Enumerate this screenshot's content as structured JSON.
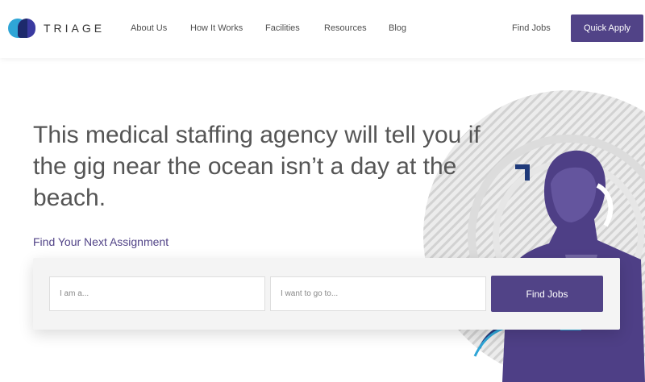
{
  "brand": {
    "name": "TRIAGE"
  },
  "nav": {
    "items": [
      {
        "label": "About Us"
      },
      {
        "label": "How It Works"
      },
      {
        "label": "Facilities"
      },
      {
        "label": "Resources"
      },
      {
        "label": "Blog"
      }
    ],
    "find_jobs": "Find Jobs",
    "quick_apply": "Quick Apply"
  },
  "hero": {
    "headline": "This medical staffing agency will tell you if the gig near the ocean isn’t a day at the beach.",
    "subhead": "Find Your Next Assignment"
  },
  "search": {
    "role_placeholder": "I am a...",
    "location_placeholder": "I want to go to...",
    "button_label": "Find Jobs"
  },
  "colors": {
    "brand_purple": "#514387",
    "logo_blue": "#2fa5d6",
    "logo_navy": "#1d2a6b"
  },
  "icons": {
    "hero_image": "person-with-beard-duotone-illustration",
    "corner_accent": "corner-bracket-icon"
  }
}
